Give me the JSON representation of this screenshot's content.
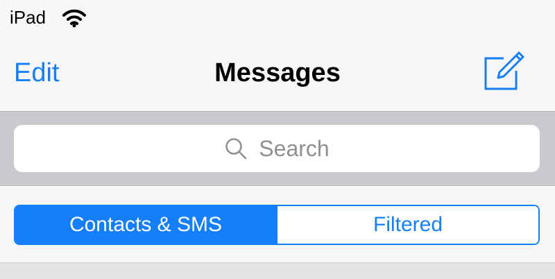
{
  "status_bar": {
    "carrier": "iPad",
    "wifi_icon": "wifi-icon"
  },
  "nav_bar": {
    "edit_label": "Edit",
    "title": "Messages",
    "compose_icon": "compose-icon"
  },
  "search": {
    "placeholder": "Search",
    "icon": "magnifier-icon"
  },
  "segmented_control": {
    "segments": [
      {
        "label": "Contacts & SMS",
        "selected": true
      },
      {
        "label": "Filtered",
        "selected": false
      }
    ]
  },
  "colors": {
    "accent": "#157efb",
    "background": "#f7f7f7",
    "search_bar_background": "#c9c9ce",
    "placeholder": "#8e8e93"
  }
}
